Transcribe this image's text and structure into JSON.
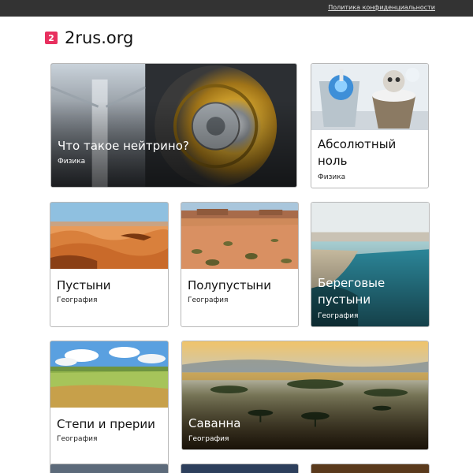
{
  "topbar": {
    "privacy_link": "Политика конфиденциальности"
  },
  "header": {
    "logo_text": "2",
    "site_name": "2rus.org"
  },
  "cards": [
    {
      "title": "Что такое нейтрино?",
      "category": "Физика",
      "image_icon": "particle-detector-photo"
    },
    {
      "title": "Абсолютный ноль",
      "category": "Физика",
      "image_icon": "robot-cups-photo"
    },
    {
      "title": "Пустыни",
      "category": "География",
      "image_icon": "desert-dunes-photo"
    },
    {
      "title": "Полупустыни",
      "category": "География",
      "image_icon": "semidesert-photo"
    },
    {
      "title": "Береговые пустыни",
      "category": "География",
      "image_icon": "coastal-desert-photo"
    },
    {
      "title": "Степи и прерии",
      "category": "География",
      "image_icon": "steppe-photo"
    },
    {
      "title": "Саванна",
      "category": "География",
      "image_icon": "savanna-photo"
    }
  ],
  "colors": {
    "topbar": "#333333",
    "logo": "#e8305f"
  }
}
